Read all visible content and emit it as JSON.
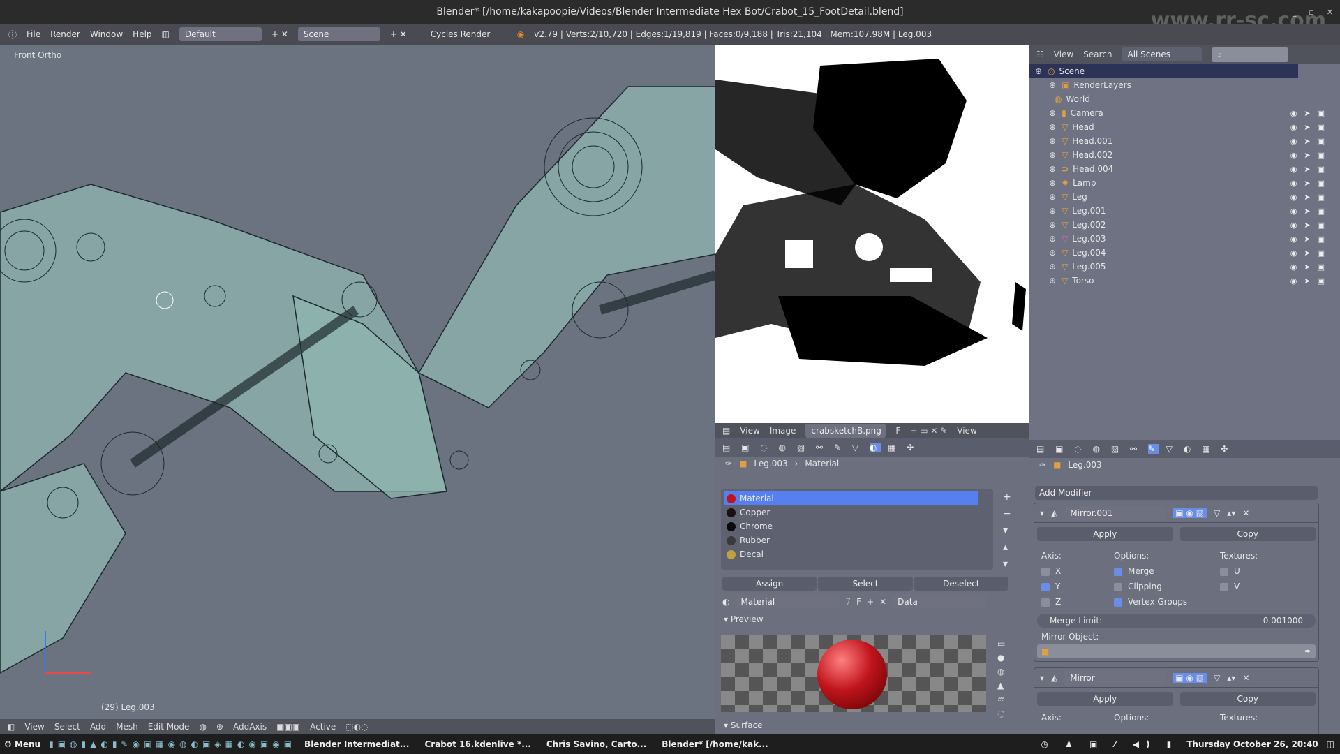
{
  "window": {
    "title": "Blender* [/home/kakapoopie/Videos/Blender Intermediate Hex Bot/Crabot_15_FootDetail.blend]",
    "buttons": [
      "_",
      "▫",
      "✕"
    ]
  },
  "infobar": {
    "menus": [
      "File",
      "Render",
      "Window",
      "Help"
    ],
    "layout": "Default",
    "scene": "Scene",
    "engine": "Cycles Render",
    "stats": "v2.79 | Verts:2/10,720 | Edges:1/19,819 | Faces:0/9,188 | Tris:21,104 | Mem:107.98M | Leg.003"
  },
  "viewport": {
    "view_label": "Front Ortho",
    "object_label": "(29) Leg.003",
    "colors": {
      "bg": "#6b7381",
      "mesh": "#8fb5b0",
      "wire": "#1c2a2c"
    }
  },
  "viewport_header": {
    "menus": [
      "View",
      "Select",
      "Add",
      "Mesh"
    ],
    "mode": "Edit Mode",
    "addon": "AddAxis",
    "pivot": "Active"
  },
  "image_editor": {
    "menus": [
      "View",
      "Image"
    ],
    "image": "crabsketchB.png",
    "fake_user": "F",
    "view": "View"
  },
  "material_panel": {
    "breadcrumb": [
      "Leg.003",
      "Material"
    ],
    "slots": [
      {
        "name": "Material",
        "color": "#c0141c",
        "selected": true
      },
      {
        "name": "Copper",
        "color": "#1a1010"
      },
      {
        "name": "Chrome",
        "color": "#0a0a0a"
      },
      {
        "name": "Rubber",
        "color": "#3a3a3a"
      },
      {
        "name": "Decal",
        "color": "#c0a040"
      }
    ],
    "assign": "Assign",
    "select": "Select",
    "deselect": "Deselect",
    "material_name": "Material",
    "users": "7",
    "fake": "F",
    "link": "Data",
    "preview_label": "Preview",
    "surface_label": "Surface"
  },
  "outliner": {
    "menus": [
      "View",
      "Search"
    ],
    "filter": "All Scenes",
    "items": [
      {
        "name": "Scene",
        "type": "scene"
      },
      {
        "name": "RenderLayers",
        "type": "render"
      },
      {
        "name": "World",
        "type": "world"
      },
      {
        "name": "Camera",
        "type": "camera"
      },
      {
        "name": "Head",
        "type": "mesh"
      },
      {
        "name": "Head.001",
        "type": "mesh"
      },
      {
        "name": "Head.002",
        "type": "mesh"
      },
      {
        "name": "Head.004",
        "type": "curve"
      },
      {
        "name": "Lamp",
        "type": "lamp"
      },
      {
        "name": "Leg",
        "type": "mesh"
      },
      {
        "name": "Leg.001",
        "type": "mesh"
      },
      {
        "name": "Leg.002",
        "type": "mesh"
      },
      {
        "name": "Leg.003",
        "type": "mesh",
        "active": true
      },
      {
        "name": "Leg.004",
        "type": "mesh"
      },
      {
        "name": "Leg.005",
        "type": "mesh"
      },
      {
        "name": "Torso",
        "type": "mesh"
      }
    ]
  },
  "modifier_panel": {
    "breadcrumb": "Leg.003",
    "add_modifier": "Add Modifier",
    "modifiers": [
      {
        "name": "Mirror.001",
        "apply": "Apply",
        "copy": "Copy",
        "axis_label": "Axis:",
        "options_label": "Options:",
        "textures_label": "Textures:",
        "axis": [
          {
            "label": "X",
            "checked": false
          },
          {
            "label": "Y",
            "checked": true
          },
          {
            "label": "Z",
            "checked": false
          }
        ],
        "options": [
          {
            "label": "Merge",
            "checked": true
          },
          {
            "label": "Clipping",
            "checked": false
          },
          {
            "label": "Vertex Groups",
            "checked": true
          }
        ],
        "textures": [
          {
            "label": "U",
            "checked": false
          },
          {
            "label": "V",
            "checked": false
          }
        ],
        "merge_limit_label": "Merge Limit:",
        "merge_limit": "0.001000",
        "mirror_object_label": "Mirror Object:"
      },
      {
        "name": "Mirror",
        "apply": "Apply",
        "copy": "Copy",
        "axis_label": "Axis:",
        "options_label": "Options:",
        "textures_label": "Textures:"
      }
    ]
  },
  "taskbar": {
    "menu": "Menu",
    "tasks": [
      "Blender Intermediat...",
      "Crabot 16.kdenlive *...",
      "Chris Savino, Carto...",
      "Blender* [/home/kak..."
    ],
    "clock": "Thursday October 26, 20:40"
  },
  "watermark": "www.rr-sc.com"
}
